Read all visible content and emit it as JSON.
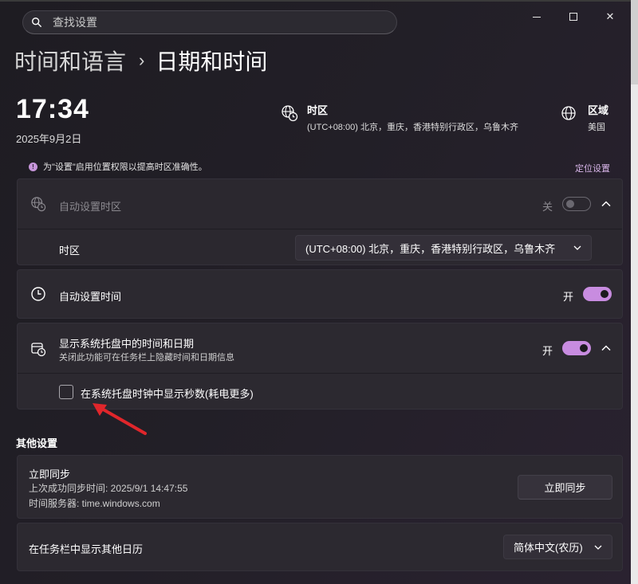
{
  "search": {
    "placeholder": "查找设置"
  },
  "breadcrumb": {
    "parent": "时间和语言",
    "separator": "›",
    "current": "日期和时间"
  },
  "clock": {
    "time": "17:34",
    "date": "2025年9月2日"
  },
  "timezone_info": {
    "title": "时区",
    "value": "(UTC+08:00) 北京，重庆，香港特别行政区，乌鲁木齐",
    "icon": "globe-clock-icon"
  },
  "region_info": {
    "title": "区域",
    "value": "美国",
    "icon": "globe-icon"
  },
  "notice": {
    "text": "为\"设置\"启用位置权限以提高时区准确性。",
    "link": "定位设置"
  },
  "auto_timezone": {
    "label": "自动设置时区",
    "state": "关"
  },
  "timezone_row": {
    "label": "时区",
    "selected": "(UTC+08:00) 北京，重庆，香港特别行政区，乌鲁木齐"
  },
  "auto_time": {
    "label": "自动设置时间",
    "state": "开"
  },
  "tray": {
    "label": "显示系统托盘中的时间和日期",
    "sub": "关闭此功能可在任务栏上隐藏时间和日期信息",
    "state": "开"
  },
  "seconds": {
    "label": "在系统托盘时钟中显示秒数(耗电更多)",
    "checked": false
  },
  "other": {
    "title": "其他设置"
  },
  "sync": {
    "title": "立即同步",
    "last": "上次成功同步时间: 2025/9/1 14:47:55",
    "server": "时间服务器: time.windows.com",
    "button": "立即同步"
  },
  "calendar": {
    "label": "在任务栏中显示其他日历",
    "selected": "简体中文(农历)"
  },
  "colors": {
    "accent": "#c88ce0",
    "annotation_arrow": "#e0262b"
  }
}
